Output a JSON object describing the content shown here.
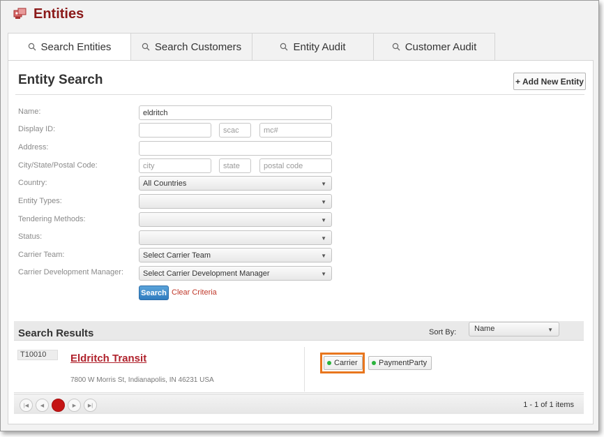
{
  "header": {
    "title": "Entities",
    "icon": "entities-icon"
  },
  "tabs": [
    {
      "label": "Search Entities",
      "active": true
    },
    {
      "label": "Search Customers",
      "active": false
    },
    {
      "label": "Entity Audit",
      "active": false
    },
    {
      "label": "Customer Audit",
      "active": false
    }
  ],
  "page": {
    "title": "Entity Search",
    "add_button": "+ Add New Entity"
  },
  "form": {
    "labels": {
      "name": "Name:",
      "display_id": "Display ID:",
      "address": "Address:",
      "city_state_postal": "City/State/Postal Code:",
      "country": "Country:",
      "entity_types": "Entity Types:",
      "tendering_methods": "Tendering Methods:",
      "status": "Status:",
      "carrier_team": "Carrier Team:",
      "carrier_dev_manager": "Carrier Development Manager:"
    },
    "name_value": "eldritch",
    "placeholders": {
      "scac": "scac",
      "mc": "mc#",
      "city": "city",
      "state": "state",
      "postal": "postal code"
    },
    "selects": {
      "country": "All Countries",
      "entity_types": "",
      "tendering_methods": "",
      "status": "",
      "carrier_team": "Select Carrier Team",
      "carrier_dev_manager": "Select Carrier Development Manager"
    },
    "search_button": "Search",
    "clear_link": "Clear Criteria"
  },
  "results": {
    "title": "Search Results",
    "sort_by_label": "Sort By:",
    "sort_by_value": "Name",
    "rows": [
      {
        "display_id": "T10010",
        "name": "Eldritch Transit",
        "address": "7800 W Morris St, Indianapolis, IN 46231 USA",
        "types": [
          "Carrier",
          "PaymentParty"
        ]
      }
    ],
    "pager": {
      "current_page": "1",
      "summary": "1 - 1 of 1 items"
    }
  },
  "colors": {
    "brand": "#8b1a1a",
    "link": "#b0222c",
    "status_active": "#29b33b",
    "highlight": "#e8761e",
    "search_button": "#2f7cbf"
  }
}
